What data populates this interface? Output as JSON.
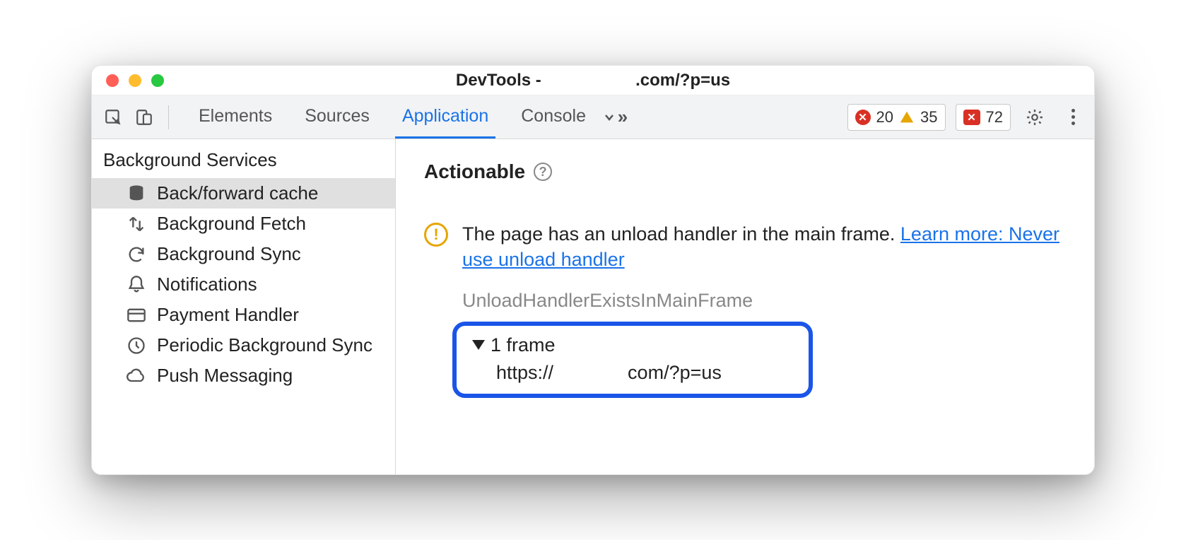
{
  "window": {
    "title_prefix": "DevTools - ",
    "title_domain": ".com/?p=us"
  },
  "toolbar": {
    "tabs": [
      "Elements",
      "Sources",
      "Application",
      "Console"
    ],
    "active_tab_index": 2,
    "errors_count": "20",
    "warnings_count": "35",
    "issues_count": "72"
  },
  "sidebar": {
    "section_heading": "Background Services",
    "items": [
      {
        "label": "Back/forward cache",
        "icon": "database",
        "selected": true
      },
      {
        "label": "Background Fetch",
        "icon": "updown",
        "selected": false
      },
      {
        "label": "Background Sync",
        "icon": "sync",
        "selected": false
      },
      {
        "label": "Notifications",
        "icon": "bell",
        "selected": false
      },
      {
        "label": "Payment Handler",
        "icon": "card",
        "selected": false
      },
      {
        "label": "Periodic Background Sync",
        "icon": "clock",
        "selected": false
      },
      {
        "label": "Push Messaging",
        "icon": "cloud",
        "selected": false
      }
    ]
  },
  "content": {
    "section_title": "Actionable",
    "issue_text_1": "The page has an unload handler in the main frame. ",
    "issue_link_text": "Learn more: Never use unload handler",
    "reason_id": "UnloadHandlerExistsInMainFrame",
    "frame_header": "1 frame",
    "frame_url": "https://              com/?p=us"
  }
}
